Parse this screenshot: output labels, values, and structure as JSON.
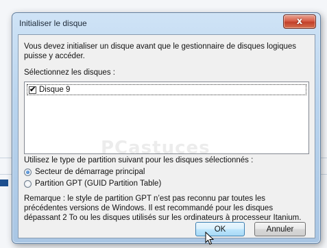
{
  "dialog": {
    "title": "Initialiser le disque",
    "close_label": "x",
    "intro_text": "Vous devez initialiser un disque avant que le gestionnaire de disques logiques puisse y accéder.",
    "intro_line1": "Vous devez initialiser un disque avant que le gestionnaire de disques logiques",
    "intro_line2": "puisse y accéder.",
    "select_label": "Sélectionnez les disques :",
    "disks": [
      {
        "label": "Disque 9",
        "checked": true
      }
    ],
    "partition_label": "Utilisez le type de partition suivant pour les disques sélectionnés :",
    "partition_options": [
      {
        "label": "Secteur de démarrage principal",
        "selected": true
      },
      {
        "label": "Partition GPT (GUID Partition Table)",
        "selected": false
      }
    ],
    "remark_line1": "Remarque : le style de partition GPT n’est pas reconnu par toutes les",
    "remark_line2": "précédentes versions de Windows. Il est recommandé pour les disques",
    "remark_line3": "dépassant 2 To ou les disques utilisés sur les ordinateurs à processeur Itanium.",
    "ok_label": "OK",
    "cancel_label": "Annuler"
  },
  "colors": {
    "accent": "#3c7fb1",
    "close": "#c2402a",
    "radio_selected": "#1f5fb2"
  },
  "icons": {
    "close": "close-icon",
    "check": "checkmark-icon",
    "cursor": "mouse-cursor-icon"
  }
}
